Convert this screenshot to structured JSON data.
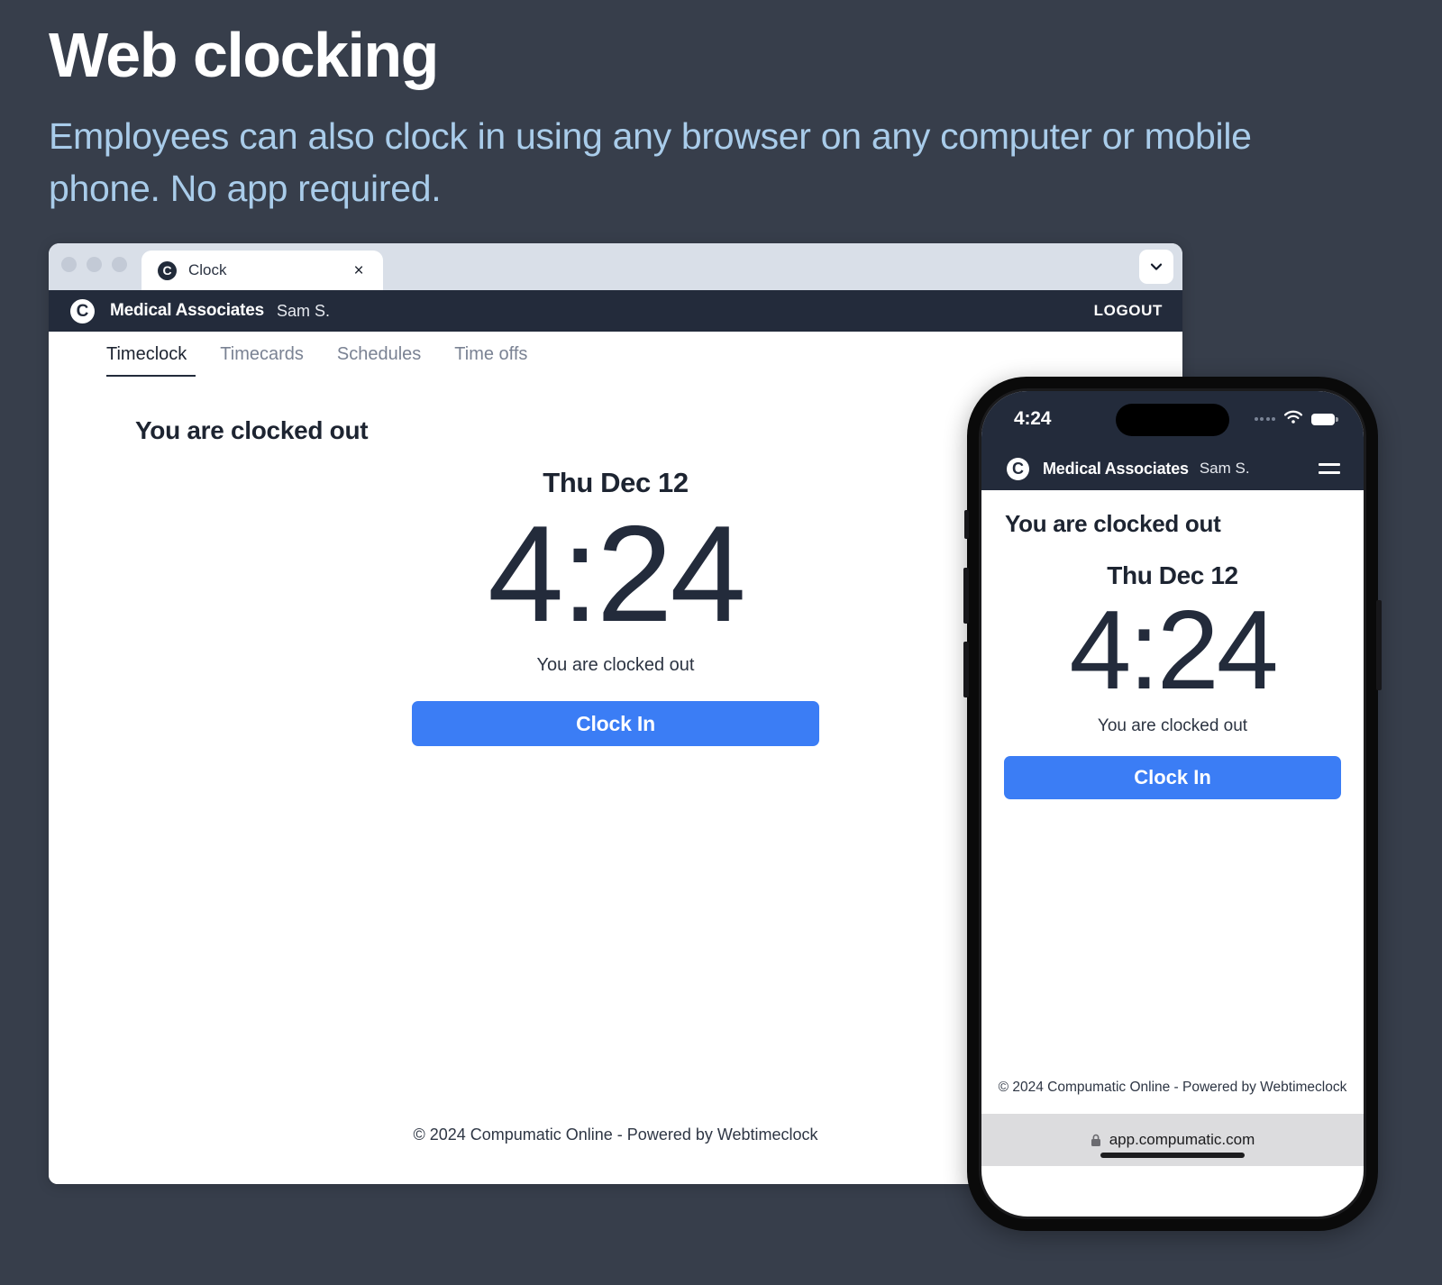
{
  "slide": {
    "headline": "Web clocking",
    "subhead": "Employees can also clock in using any browser on any computer or mobile phone. No app required.",
    "background_color": "#373e4b",
    "headline_color": "#ffffff",
    "subhead_color": "#a9ccea",
    "accent_color": "#3b7df5",
    "navbar_color": "#232b3b"
  },
  "browser": {
    "traffic_lights": [
      "close",
      "minimize",
      "maximize"
    ],
    "tab": {
      "favicon_letter": "C",
      "title": "Clock",
      "close_label": "×"
    },
    "tabbar_chevron_icon": "chevron-down-icon"
  },
  "app": {
    "navbar": {
      "logo_letter": "C",
      "organization": "Medical Associates",
      "user": "Sam S.",
      "logout_label": "LOGOUT"
    },
    "tabs": [
      {
        "label": "Timeclock",
        "active": true
      },
      {
        "label": "Timecards",
        "active": false
      },
      {
        "label": "Schedules",
        "active": false
      },
      {
        "label": "Time offs",
        "active": false
      }
    ],
    "status_heading": "You are clocked out",
    "clock": {
      "date": "Thu Dec 12",
      "time": "4:24",
      "status": "You are clocked out",
      "button_label": "Clock In"
    },
    "footer": "© 2024 Compumatic Online - Powered by Webtimeclock"
  },
  "phone": {
    "statusbar": {
      "time": "4:24",
      "signal_icon": "signal-dots-icon",
      "wifi_icon": "wifi-icon",
      "battery_icon": "battery-icon"
    },
    "navbar": {
      "logo_letter": "C",
      "organization": "Medical Associates",
      "user": "Sam S.",
      "menu_icon": "hamburger-menu-icon"
    },
    "status_heading": "You are clocked out",
    "clock": {
      "date": "Thu Dec 12",
      "time": "4:24",
      "status": "You are clocked out",
      "button_label": "Clock In"
    },
    "footer": "© 2024 Compumatic Online - Powered by Webtimeclock",
    "urlbar": {
      "lock_icon": "lock-icon",
      "url": "app.compumatic.com"
    }
  }
}
